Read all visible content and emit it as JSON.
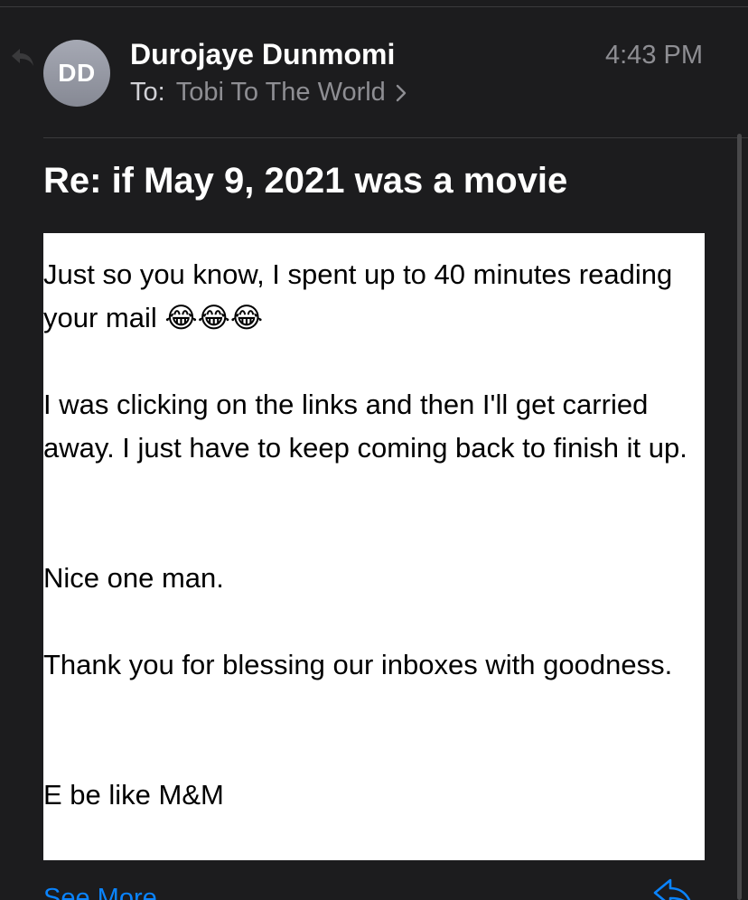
{
  "message": {
    "sender_initials": "DD",
    "sender_name": "Durojaye Dunmomi",
    "time": "4:43 PM",
    "to_label": "To:",
    "recipient": "Tobi To The World",
    "subject": "Re: if May 9, 2021 was a movie"
  },
  "body": {
    "paragraphs": [
      "Just so you know, I spent up to 40 minutes reading your mail 😂😂😂",
      "I was clicking on the links and then I'll get carried away. I just have to keep coming back to finish it up.",
      "Nice one man.",
      "Thank you for blessing our inboxes with goodness.",
      "E be like M&M"
    ]
  },
  "footer": {
    "see_more_label": "See More"
  },
  "icons": {
    "reply_indicator": "reply-arrow-icon",
    "recipient_chevron": "chevron-right-icon",
    "reply_button": "reply-arrow-icon"
  },
  "colors": {
    "background": "#1c1c1e",
    "accent": "#0a84ff",
    "secondary_text": "#8e8e93",
    "avatar": "#9a9da8"
  }
}
